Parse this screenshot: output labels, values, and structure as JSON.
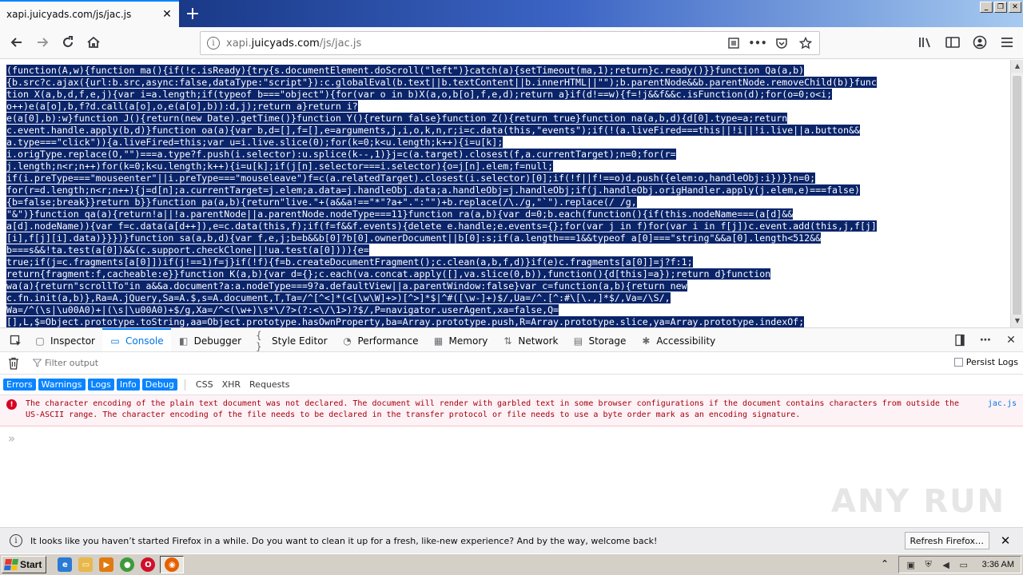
{
  "tab": {
    "title": "xapi.juicyads.com/js/jac.js"
  },
  "url": {
    "scheme_prefix": "xapi.",
    "host": "juicyads.com",
    "path": "/js/jac.js"
  },
  "source_lines": [
    "(function(A,w){function ma(){if(!c.isReady){try{s.documentElement.doScroll(\"left\")}catch(a){setTimeout(ma,1);return}c.ready()}}function Qa(a,b)",
    "{b.src?c.ajax({url:b.src,async:false,dataType:\"script\"}):c.globalEval(b.text||b.textContent||b.innerHTML||\"\");b.parentNode&&b.parentNode.removeChild(b)}func",
    "tion X(a,b,d,f,e,j){var i=a.length;if(typeof b===\"object\"){for(var o in b)X(a,o,b[o],f,e,d);return a}if(d!==w){f=!j&&f&&c.isFunction(d);for(o=0;o<i;",
    "o++)e(a[o],b,f?d.call(a[o],o,e(a[o],b)):d,j);return a}return i?",
    "e(a[0],b):w}function J(){return(new Date).getTime()}function Y(){return false}function Z(){return true}function na(a,b,d){d[0].type=a;return",
    "c.event.handle.apply(b,d)}function oa(a){var b,d=[],f=[],e=arguments,j,i,o,k,n,r;i=c.data(this,\"events\");if(!(a.liveFired===this||!i||!i.live||a.button&&",
    "a.type===\"click\")){a.liveFired=this;var u=i.live.slice(0);for(k=0;k<u.length;k++){i=u[k];",
    "i.origType.replace(O,\"\")===a.type?f.push(i.selector):u.splice(k--,1)}j=c(a.target).closest(f,a.currentTarget);n=0;for(r=",
    "j.length;n<r;n++)for(k=0;k<u.length;k++){i=u[k];if(j[n].selector===i.selector){o=j[n].elem;f=null;",
    "if(i.preType===\"mouseenter\"||i.preType===\"mouseleave\")f=c(a.relatedTarget).closest(i.selector)[0];if(!f||f!==o)d.push({elem:o,handleObj:i})}}n=0;",
    "for(r=d.length;n<r;n++){j=d[n];a.currentTarget=j.elem;a.data=j.handleObj.data;a.handleObj=j.handleObj;if(j.handleObj.origHandler.apply(j.elem,e)===false)",
    "{b=false;break}}return b}}function pa(a,b){return\"live.\"+(a&&a!==\"*\"?a+\".\":\"\")+b.replace(/\\./g,\"`\").replace(/ /g,",
    "\"&\")}function qa(a){return!a||!a.parentNode||a.parentNode.nodeType===11}function ra(a,b){var d=0;b.each(function(){if(this.nodeName===(a[d]&&",
    "a[d].nodeName)){var f=c.data(a[d++]),e=c.data(this,f);if(f=f&&f.events){delete e.handle;e.events={};for(var j in f)for(var i in f[j])c.event.add(this,j,f[j]",
    "[i],f[j][i].data)}}})}function sa(a,b,d){var f,e,j;b=b&&b[0]?b[0].ownerDocument||b[0]:s;if(a.length===1&&typeof a[0]===\"string\"&&a[0].length<512&&",
    "b===s&&!ta.test(a[0])&&(c.support.checkClone||!ua.test(a[0]))){e=",
    "true;if(j=c.fragments[a[0]])if(j!==1)f=j}if(!f){f=b.createDocumentFragment();c.clean(a,b,f,d)}if(e)c.fragments[a[0]]=j?f:1;",
    "return{fragment:f,cacheable:e}}function K(a,b){var d={};c.each(va.concat.apply([],va.slice(0,b)),function(){d[this]=a});return d}function",
    "wa(a){return\"scrollTo\"in a&&a.document?a:a.nodeType===9?a.defaultView||a.parentWindow:false}var c=function(a,b){return new",
    "c.fn.init(a,b)},Ra=A.jQuery,Sa=A.$,s=A.document,T,Ta=/^[^<]*(<[\\w\\W]+>)[^>]*$|^#([\\w-]+)$/,Ua=/^.[^:#\\[\\.,]*$/,Va=/\\S/,",
    "Wa=/^(\\s|\\u00A0)+|(\\s|\\u00A0)+$/g,Xa=/^<(\\w+)\\s*\\/?>(?:<\\/\\1>)?$/,P=navigator.userAgent,xa=false,Q=",
    "[],L,$=Object.prototype.toString,aa=Object.prototype.hasOwnProperty,ba=Array.prototype.push,R=Array.prototype.slice,ya=Array.prototype.indexOf;"
  ],
  "devtools": {
    "tabs": [
      {
        "label": "Inspector",
        "icon": "inspector-icon"
      },
      {
        "label": "Console",
        "icon": "console-icon"
      },
      {
        "label": "Debugger",
        "icon": "debugger-icon"
      },
      {
        "label": "Style Editor",
        "icon": "style-editor-icon"
      },
      {
        "label": "Performance",
        "icon": "performance-icon"
      },
      {
        "label": "Memory",
        "icon": "memory-icon"
      },
      {
        "label": "Network",
        "icon": "network-icon"
      },
      {
        "label": "Storage",
        "icon": "storage-icon"
      },
      {
        "label": "Accessibility",
        "icon": "accessibility-icon"
      }
    ],
    "active_tab": "Console",
    "filter_placeholder": "Filter output",
    "persist_logs": "Persist Logs",
    "levels": [
      "Errors",
      "Warnings",
      "Logs",
      "Info",
      "Debug"
    ],
    "categories": [
      "CSS",
      "XHR",
      "Requests"
    ],
    "message": {
      "text": "The character encoding of the plain text document was not declared. The document will render with garbled text in some browser configurations if the document contains characters from outside the US-ASCII range. The character encoding of the file needs to be declared in the transfer protocol or file needs to use a byte order mark as an encoding signature.",
      "source": "jac.js"
    },
    "prompt": "»"
  },
  "watermark": "ANY RUN",
  "notification": {
    "text": "It looks like you haven’t started Firefox in a while. Do you want to clean it up for a fresh, like-new experience? And by the way, welcome back!",
    "button": "Refresh Firefox…"
  },
  "taskbar": {
    "start": "Start",
    "clock": "3:36 AM"
  },
  "colors": {
    "selection": "#0a246a",
    "accent": "#0a84ff",
    "error": "#d70022"
  }
}
